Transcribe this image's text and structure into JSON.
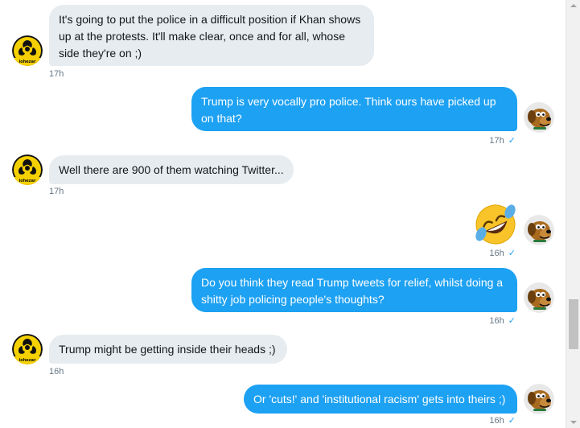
{
  "conversation": {
    "messages": [
      {
        "direction": "in",
        "text": "It's going to put the police in a difficult position if Khan shows up at the protests. It'll make clear, once and for all, whose side they're on ;)",
        "time": "17h"
      },
      {
        "direction": "out",
        "text": "Trump is very vocally pro police. Think ours have picked up on that?",
        "time": "17h",
        "read": "✓"
      },
      {
        "direction": "in",
        "text": "Well there are 900 of them watching Twitter...",
        "time": "17h"
      },
      {
        "direction": "out",
        "emoji": "rolling-on-the-floor-laughing-emoji",
        "time": "16h",
        "read": "✓"
      },
      {
        "direction": "out",
        "text": "Do you think they read Trump tweets for relief, whilst doing a shitty job policing people's thoughts?",
        "time": "16h",
        "read": "✓"
      },
      {
        "direction": "in",
        "text": "Trump might be getting inside their heads ;)",
        "time": "16h"
      },
      {
        "direction": "out",
        "text": "Or 'cuts!' and 'institutional racism' gets into theirs ;)",
        "time": "16h",
        "read": "✓"
      }
    ],
    "other_avatar": {
      "icon": "biohazard-avatar-icon",
      "partial_text": "iohezar"
    },
    "self_avatar": {
      "icon": "scooby-doo-avatar-icon"
    }
  },
  "colors": {
    "incoming_bubble": "#e6ecf0",
    "outgoing_bubble": "#1da1f2",
    "meta_text": "#657786",
    "read_check": "#1da1f2",
    "biohazard_yellow": "#f5d000"
  }
}
